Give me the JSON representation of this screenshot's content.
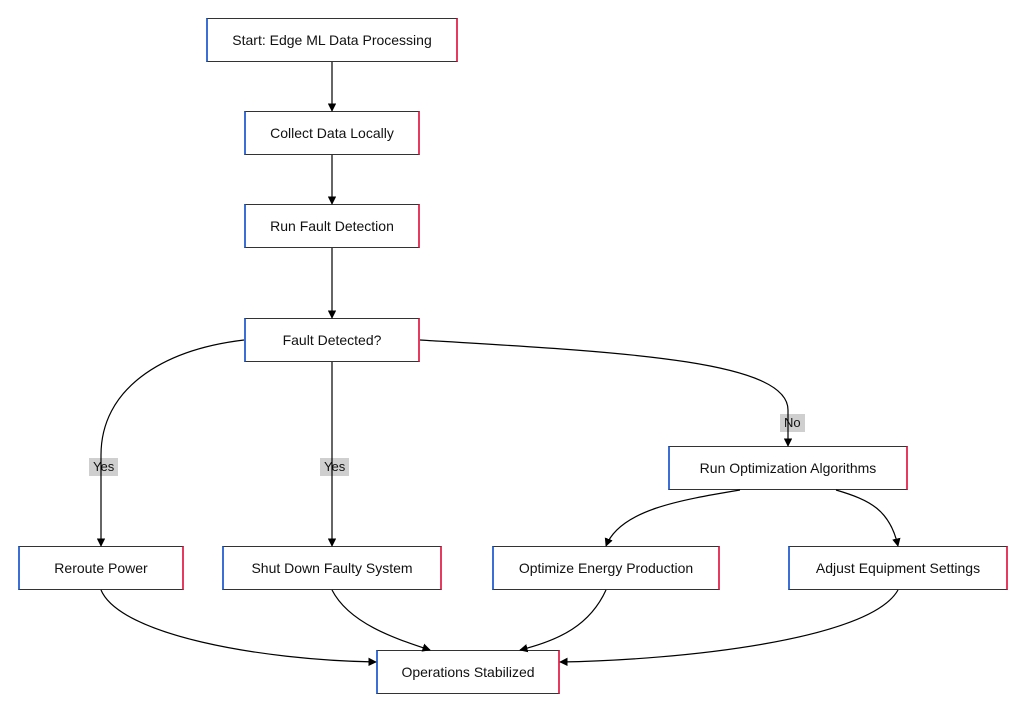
{
  "nodes": {
    "start": "Start: Edge ML Data Processing",
    "collect": "Collect Data Locally",
    "detect": "Run Fault Detection",
    "decision": "Fault Detected?",
    "runopt": "Run Optimization Algorithms",
    "reroute": "Reroute Power",
    "shutdown": "Shut Down Faulty System",
    "optimize": "Optimize Energy Production",
    "adjust": "Adjust Equipment Settings",
    "stable": "Operations Stabilized"
  },
  "labels": {
    "yes": "Yes",
    "no": "No"
  }
}
